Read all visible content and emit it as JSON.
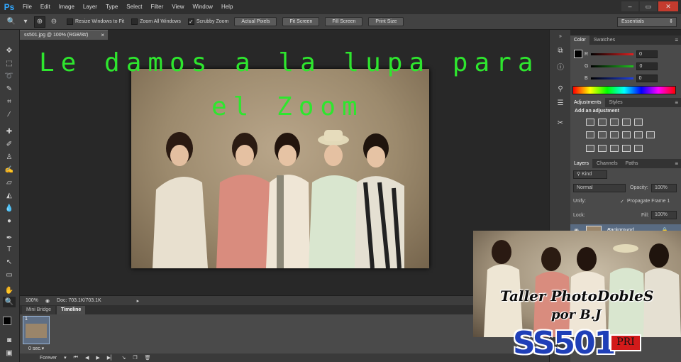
{
  "app": {
    "logo": "Ps"
  },
  "menu": [
    "File",
    "Edit",
    "Image",
    "Layer",
    "Type",
    "Select",
    "Filter",
    "View",
    "Window",
    "Help"
  ],
  "window_controls": {
    "minimize": "–",
    "restore": "▭",
    "close": "✕"
  },
  "options_bar": {
    "resize_windows": "Resize Windows to Fit",
    "zoom_all": "Zoom All Windows",
    "scrubby_zoom": "Scrubby Zoom",
    "scrubby_checked": true,
    "buttons": [
      "Actual Pixels",
      "Fit Screen",
      "Fill Screen",
      "Print Size"
    ],
    "workspace": "Essentials"
  },
  "document": {
    "tab_title": "ss501.jpg @ 100% (RGB/8#)",
    "close": "×"
  },
  "headline": {
    "line1": "Le damos a la lupa para",
    "line2": "el Zoom"
  },
  "status": {
    "zoom": "100%",
    "doc": "Doc: 703.1K/703.1K"
  },
  "bottom_panel": {
    "tabs": [
      "Mini Bridge",
      "Timeline"
    ],
    "frame_number": "1",
    "frame_delay": "0 sec.▾",
    "loop": "Forever"
  },
  "color_panel": {
    "tabs": [
      "Color",
      "Swatches"
    ],
    "channels": [
      {
        "label": "R",
        "value": "0",
        "color": "#e02020"
      },
      {
        "label": "G",
        "value": "0",
        "color": "#20c020"
      },
      {
        "label": "B",
        "value": "0",
        "color": "#2040e0"
      }
    ]
  },
  "adjustments_panel": {
    "tabs": [
      "Adjustments",
      "Styles"
    ],
    "title": "Add an adjustment"
  },
  "layers_panel": {
    "tabs": [
      "Layers",
      "Channels",
      "Paths"
    ],
    "kind": "Kind",
    "blend_mode": "Normal",
    "opacity_label": "Opacity:",
    "opacity": "100%",
    "unify_label": "Unify:",
    "propagate": "Propagate Frame 1",
    "lock_label": "Lock:",
    "fill_label": "Fill:",
    "fill": "100%",
    "layer_name": "Background"
  },
  "watermark": {
    "title": "Taller PhotoDobleS",
    "subtitle": "por B.J",
    "logo": "SS501",
    "badge": "PRI"
  }
}
